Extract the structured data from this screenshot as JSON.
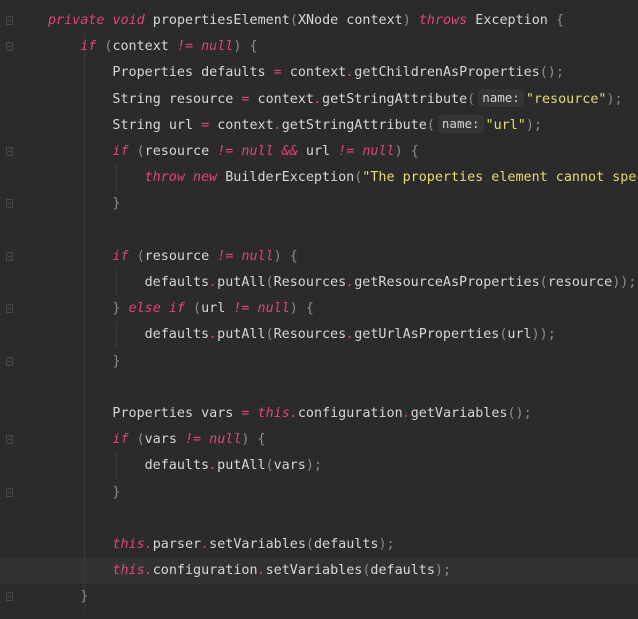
{
  "editor": {
    "lines": [
      {
        "indent": 0,
        "fold": true,
        "tokens": [
          {
            "t": "private",
            "c": "kw"
          },
          {
            "t": " "
          },
          {
            "t": "void",
            "c": "kw"
          },
          {
            "t": " propertiesElement"
          },
          {
            "t": "(",
            "c": "pn"
          },
          {
            "t": "XNode context"
          },
          {
            "t": ")",
            "c": "pn"
          },
          {
            "t": " "
          },
          {
            "t": "throws",
            "c": "kw"
          },
          {
            "t": " Exception "
          },
          {
            "t": "{",
            "c": "pn"
          }
        ]
      },
      {
        "indent": 1,
        "fold": true,
        "tokens": [
          {
            "t": "if",
            "c": "kw"
          },
          {
            "t": " "
          },
          {
            "t": "(",
            "c": "pn"
          },
          {
            "t": "context "
          },
          {
            "t": "!=",
            "c": "kw"
          },
          {
            "t": " "
          },
          {
            "t": "null",
            "c": "kw"
          },
          {
            "t": ")",
            "c": "pn"
          },
          {
            "t": " "
          },
          {
            "t": "{",
            "c": "pn"
          }
        ]
      },
      {
        "indent": 2,
        "fold": false,
        "tokens": [
          {
            "t": "Properties defaults "
          },
          {
            "t": "=",
            "c": "kw"
          },
          {
            "t": " context"
          },
          {
            "t": ".",
            "c": "kw"
          },
          {
            "t": "getChildrenAsProperties"
          },
          {
            "t": "();",
            "c": "pn"
          }
        ]
      },
      {
        "indent": 2,
        "fold": false,
        "tokens": [
          {
            "t": "String resource "
          },
          {
            "t": "=",
            "c": "kw"
          },
          {
            "t": " context"
          },
          {
            "t": ".",
            "c": "kw"
          },
          {
            "t": "getStringAttribute"
          },
          {
            "t": "(",
            "c": "pn"
          },
          {
            "t": "name:",
            "c": "hint"
          },
          {
            "t": "\"resource\"",
            "c": "str"
          },
          {
            "t": ");",
            "c": "pn"
          }
        ]
      },
      {
        "indent": 2,
        "fold": false,
        "tokens": [
          {
            "t": "String url "
          },
          {
            "t": "=",
            "c": "kw"
          },
          {
            "t": " context"
          },
          {
            "t": ".",
            "c": "kw"
          },
          {
            "t": "getStringAttribute"
          },
          {
            "t": "(",
            "c": "pn"
          },
          {
            "t": "name:",
            "c": "hint"
          },
          {
            "t": "\"url\"",
            "c": "str"
          },
          {
            "t": ");",
            "c": "pn"
          }
        ]
      },
      {
        "indent": 2,
        "fold": true,
        "tokens": [
          {
            "t": "if",
            "c": "kw"
          },
          {
            "t": " "
          },
          {
            "t": "(",
            "c": "pn"
          },
          {
            "t": "resource "
          },
          {
            "t": "!=",
            "c": "kw"
          },
          {
            "t": " "
          },
          {
            "t": "null",
            "c": "kw"
          },
          {
            "t": " "
          },
          {
            "t": "&&",
            "c": "kw"
          },
          {
            "t": " url "
          },
          {
            "t": "!=",
            "c": "kw"
          },
          {
            "t": " "
          },
          {
            "t": "null",
            "c": "kw"
          },
          {
            "t": ")",
            "c": "pn"
          },
          {
            "t": " "
          },
          {
            "t": "{",
            "c": "pn"
          }
        ]
      },
      {
        "indent": 3,
        "fold": false,
        "tokens": [
          {
            "t": "throw",
            "c": "kw"
          },
          {
            "t": " "
          },
          {
            "t": "new",
            "c": "kw"
          },
          {
            "t": " BuilderException"
          },
          {
            "t": "(",
            "c": "pn"
          },
          {
            "t": "\"The properties element cannot spec",
            "c": "str"
          }
        ]
      },
      {
        "indent": 2,
        "fold": true,
        "tokens": [
          {
            "t": "}",
            "c": "pn"
          }
        ]
      },
      {
        "indent": 2,
        "fold": false,
        "tokens": []
      },
      {
        "indent": 2,
        "fold": true,
        "tokens": [
          {
            "t": "if",
            "c": "kw"
          },
          {
            "t": " "
          },
          {
            "t": "(",
            "c": "pn"
          },
          {
            "t": "resource "
          },
          {
            "t": "!=",
            "c": "kw"
          },
          {
            "t": " "
          },
          {
            "t": "null",
            "c": "kw"
          },
          {
            "t": ")",
            "c": "pn"
          },
          {
            "t": " "
          },
          {
            "t": "{",
            "c": "pn"
          }
        ]
      },
      {
        "indent": 3,
        "fold": false,
        "tokens": [
          {
            "t": "defaults"
          },
          {
            "t": ".",
            "c": "kw"
          },
          {
            "t": "putAll"
          },
          {
            "t": "(",
            "c": "pn"
          },
          {
            "t": "Resources"
          },
          {
            "t": ".",
            "c": "kw"
          },
          {
            "t": "getResourceAsProperties"
          },
          {
            "t": "(",
            "c": "pn"
          },
          {
            "t": "resource"
          },
          {
            "t": "));",
            "c": "pn"
          }
        ]
      },
      {
        "indent": 2,
        "fold": true,
        "tokens": [
          {
            "t": "}",
            "c": "pn"
          },
          {
            "t": " "
          },
          {
            "t": "else",
            "c": "kw"
          },
          {
            "t": " "
          },
          {
            "t": "if",
            "c": "kw"
          },
          {
            "t": " "
          },
          {
            "t": "(",
            "c": "pn"
          },
          {
            "t": "url "
          },
          {
            "t": "!=",
            "c": "kw"
          },
          {
            "t": " "
          },
          {
            "t": "null",
            "c": "kw"
          },
          {
            "t": ")",
            "c": "pn"
          },
          {
            "t": " "
          },
          {
            "t": "{",
            "c": "pn"
          }
        ]
      },
      {
        "indent": 3,
        "fold": false,
        "tokens": [
          {
            "t": "defaults"
          },
          {
            "t": ".",
            "c": "kw"
          },
          {
            "t": "putAll"
          },
          {
            "t": "(",
            "c": "pn"
          },
          {
            "t": "Resources"
          },
          {
            "t": ".",
            "c": "kw"
          },
          {
            "t": "getUrlAsProperties"
          },
          {
            "t": "(",
            "c": "pn"
          },
          {
            "t": "url"
          },
          {
            "t": "));",
            "c": "pn"
          }
        ]
      },
      {
        "indent": 2,
        "fold": true,
        "tokens": [
          {
            "t": "}",
            "c": "pn"
          }
        ]
      },
      {
        "indent": 2,
        "fold": false,
        "tokens": []
      },
      {
        "indent": 2,
        "fold": false,
        "tokens": [
          {
            "t": "Properties vars "
          },
          {
            "t": "=",
            "c": "kw"
          },
          {
            "t": " "
          },
          {
            "t": "this",
            "c": "kw"
          },
          {
            "t": ".",
            "c": "kw"
          },
          {
            "t": "configuration"
          },
          {
            "t": ".",
            "c": "kw"
          },
          {
            "t": "getVariables"
          },
          {
            "t": "();",
            "c": "pn"
          }
        ]
      },
      {
        "indent": 2,
        "fold": true,
        "tokens": [
          {
            "t": "if",
            "c": "kw"
          },
          {
            "t": " "
          },
          {
            "t": "(",
            "c": "pn"
          },
          {
            "t": "vars "
          },
          {
            "t": "!=",
            "c": "kw"
          },
          {
            "t": " "
          },
          {
            "t": "null",
            "c": "kw"
          },
          {
            "t": ")",
            "c": "pn"
          },
          {
            "t": " "
          },
          {
            "t": "{",
            "c": "pn"
          }
        ]
      },
      {
        "indent": 3,
        "fold": false,
        "tokens": [
          {
            "t": "defaults"
          },
          {
            "t": ".",
            "c": "kw"
          },
          {
            "t": "putAll"
          },
          {
            "t": "(",
            "c": "pn"
          },
          {
            "t": "vars"
          },
          {
            "t": ");",
            "c": "pn"
          }
        ]
      },
      {
        "indent": 2,
        "fold": true,
        "tokens": [
          {
            "t": "}",
            "c": "pn"
          }
        ]
      },
      {
        "indent": 2,
        "fold": false,
        "tokens": []
      },
      {
        "indent": 2,
        "fold": false,
        "tokens": [
          {
            "t": "this",
            "c": "kw"
          },
          {
            "t": ".",
            "c": "kw"
          },
          {
            "t": "parser"
          },
          {
            "t": ".",
            "c": "kw"
          },
          {
            "t": "setVariables"
          },
          {
            "t": "(",
            "c": "pn"
          },
          {
            "t": "defaults"
          },
          {
            "t": ");",
            "c": "pn"
          }
        ]
      },
      {
        "indent": 2,
        "fold": false,
        "current": true,
        "tokens": [
          {
            "t": "this",
            "c": "kw"
          },
          {
            "t": ".",
            "c": "kw"
          },
          {
            "t": "configuration"
          },
          {
            "t": ".",
            "c": "kw"
          },
          {
            "t": "setVariables"
          },
          {
            "t": "(",
            "c": "pn"
          },
          {
            "t": "defaults"
          },
          {
            "t": ");",
            "c": "pn"
          }
        ]
      },
      {
        "indent": 1,
        "fold": true,
        "tokens": [
          {
            "t": "}",
            "c": "pn"
          }
        ]
      }
    ]
  },
  "colors": {
    "background": "#2b2b2b",
    "keyword": "#e0457b",
    "string": "#e6db74",
    "text": "#d6d6d6",
    "current_line": "#323232"
  }
}
